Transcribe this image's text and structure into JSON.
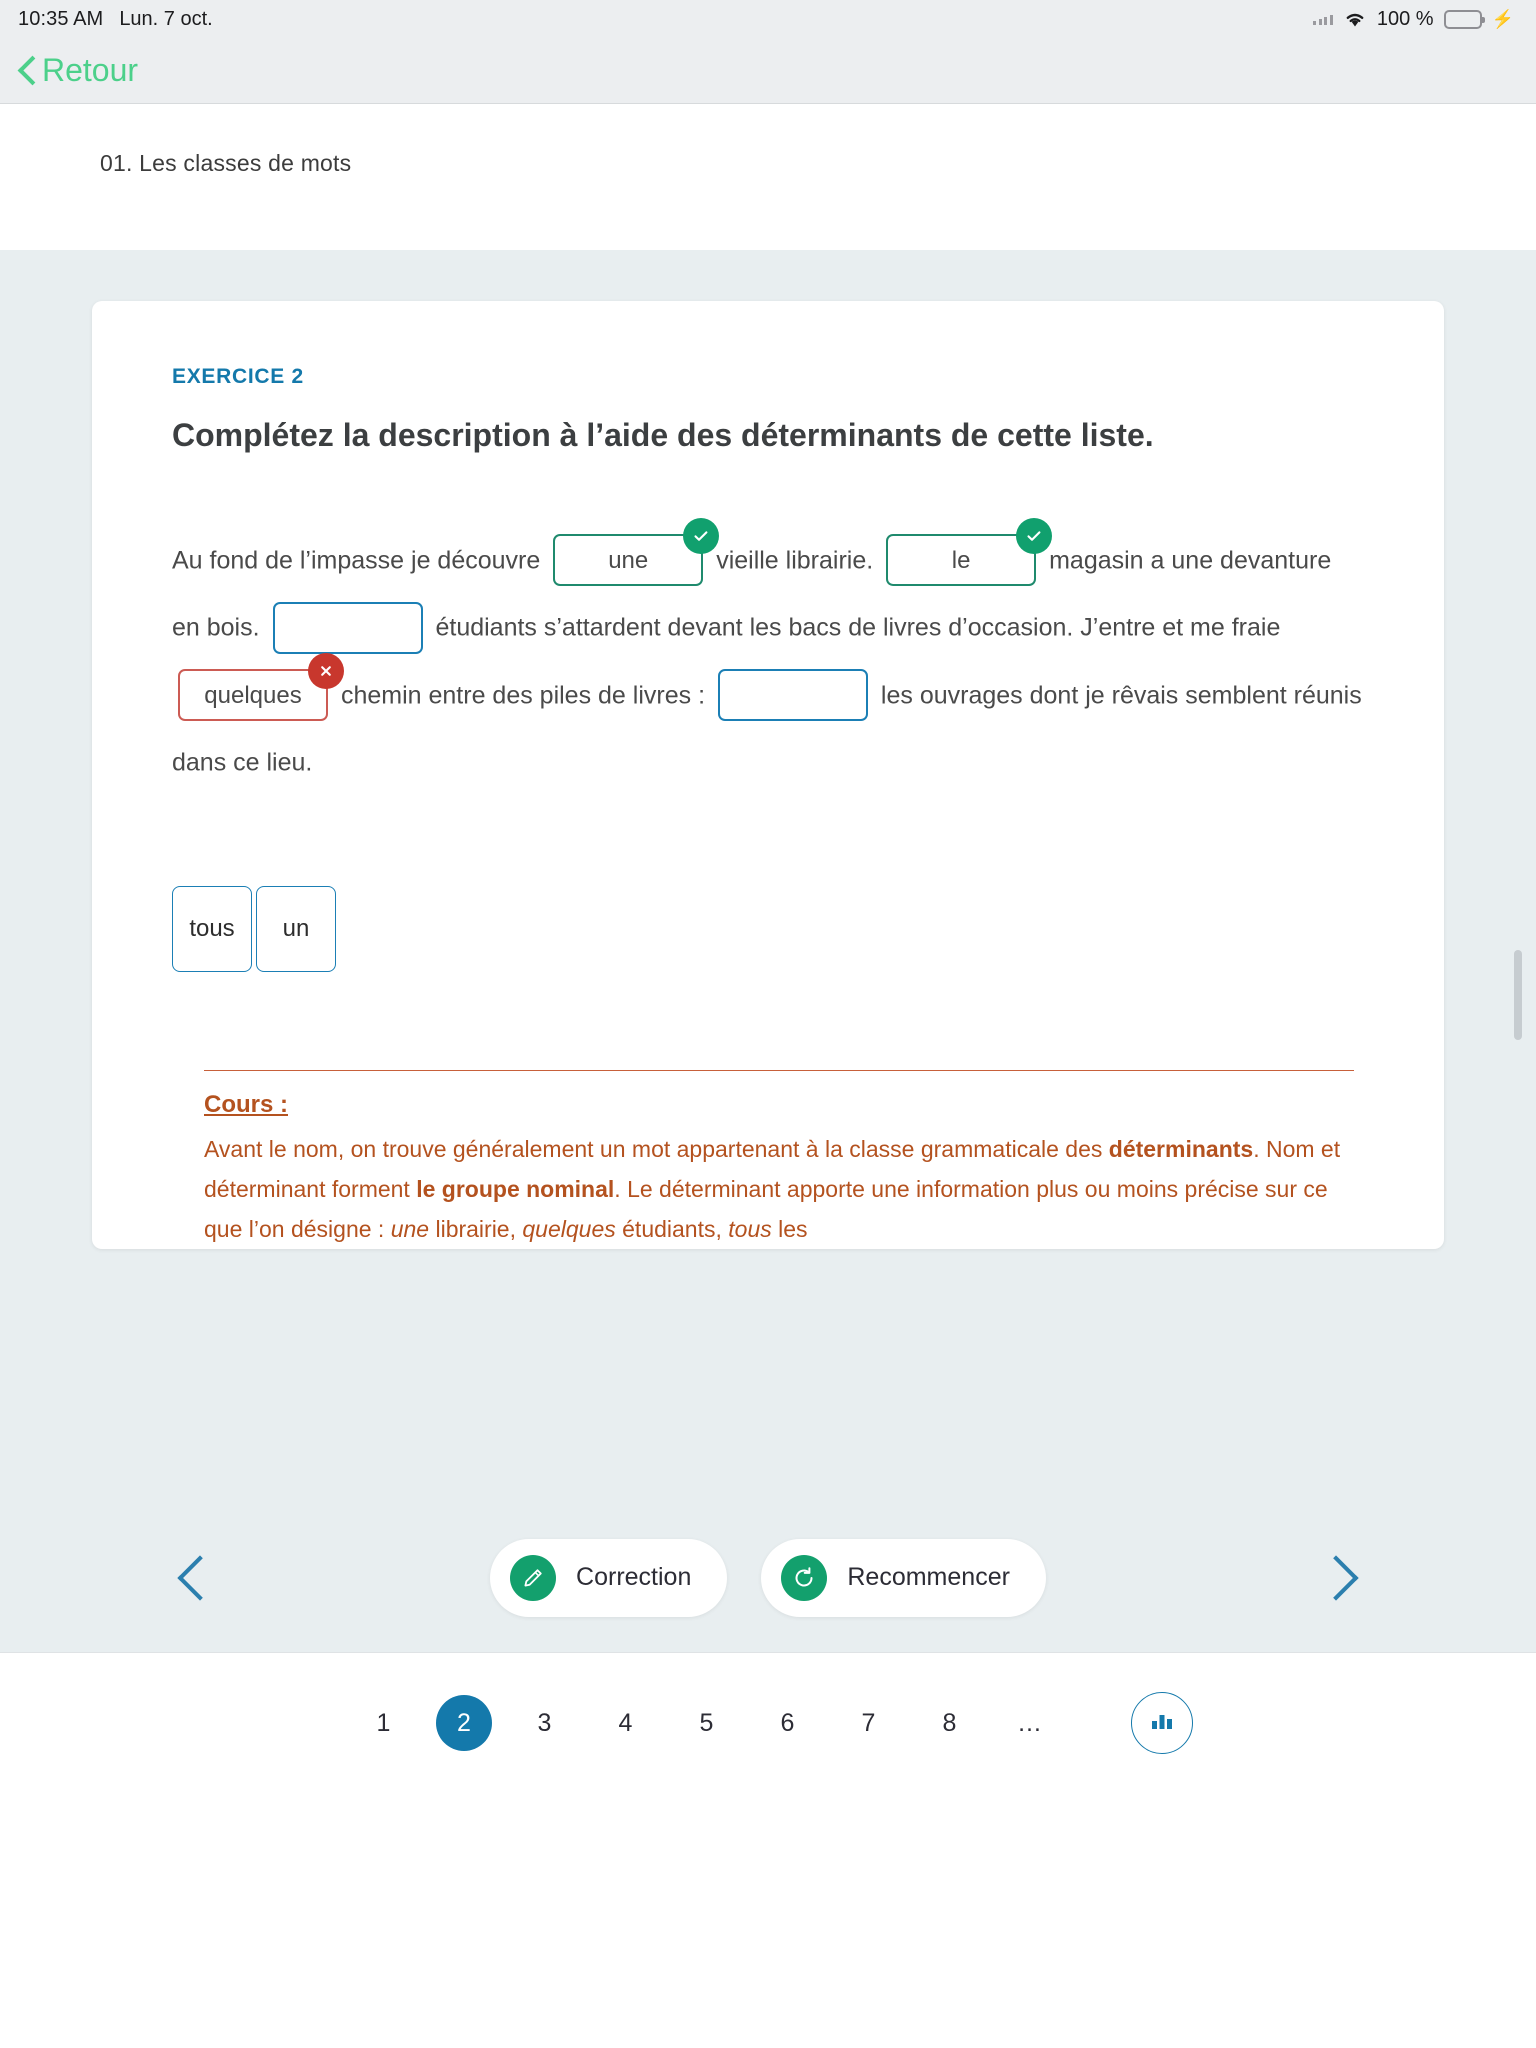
{
  "statusbar": {
    "time": "10:35 AM",
    "date": "Lun. 7 oct.",
    "battery_percent": "100 %",
    "wifi_icon": "wifi-icon",
    "signal_icon": "signal-dots-icon",
    "battery_icon": "battery-full-icon",
    "charging_icon": "lightning-bolt-icon"
  },
  "navbar": {
    "back_label": "Retour",
    "back_icon": "chevron-left-icon",
    "accent_color": "#4cd08a"
  },
  "lesson": {
    "title": "01. Les classes de mots"
  },
  "exercise": {
    "label": "EXERCICE 2",
    "label_color": "#1479ab",
    "heading": "Complétez la description à l’aide des déterminants de cette liste.",
    "segments": [
      {
        "type": "text",
        "value": "Au fond de l’impasse je découvre"
      },
      {
        "type": "blank",
        "value": "une",
        "state": "ok",
        "badge": "check-icon"
      },
      {
        "type": "text",
        "value": "vieille librairie."
      },
      {
        "type": "blank",
        "value": "le",
        "state": "ok",
        "badge": "check-icon"
      },
      {
        "type": "text",
        "value": "magasin a une devanture en bois."
      },
      {
        "type": "blank",
        "value": "",
        "state": "empty",
        "badge": ""
      },
      {
        "type": "text",
        "value": "étudiants s’attardent devant les bacs de livres d’occasion. J’entre et me fraie"
      },
      {
        "type": "blank",
        "value": "quelques",
        "state": "ko",
        "badge": "cross-icon"
      },
      {
        "type": "text",
        "value": "chemin entre des piles de livres :"
      },
      {
        "type": "blank",
        "value": "",
        "state": "empty",
        "badge": ""
      },
      {
        "type": "text",
        "value": "les ouvrages dont je rêvais semblent réunis dans ce lieu."
      }
    ],
    "wordbank": [
      "tous",
      "un"
    ],
    "state_colors": {
      "ok": "#1f8a6d",
      "ko": "#cc5b54",
      "empty": "#1b7fb5",
      "badge_ok": "#11a06e",
      "badge_ko": "#c8372d"
    }
  },
  "cours": {
    "title": "Cours :",
    "color": "#b4521f",
    "paragraph_html": "Avant le nom, on trouve généralement un mot appartenant à la classe grammaticale des <b>déterminants</b>. Nom et déterminant forment <b>le groupe nominal</b>. Le déterminant apporte une information plus ou moins précise sur ce que l’on désigne : <i>une</i> librairie, <i>quelques</i> étudiants, <i>tous</i> les"
  },
  "actions": {
    "prev_icon": "chevron-left-icon",
    "next_icon": "chevron-right-icon",
    "correction": {
      "label": "Correction",
      "icon": "pencil-icon"
    },
    "restart": {
      "label": "Recommencer",
      "icon": "refresh-icon"
    }
  },
  "pagination": {
    "pages": [
      "1",
      "2",
      "3",
      "4",
      "5",
      "6",
      "7",
      "8"
    ],
    "active": "2",
    "ellipsis": "…",
    "stats_icon": "bar-chart-icon",
    "accent_color": "#1479ab"
  }
}
